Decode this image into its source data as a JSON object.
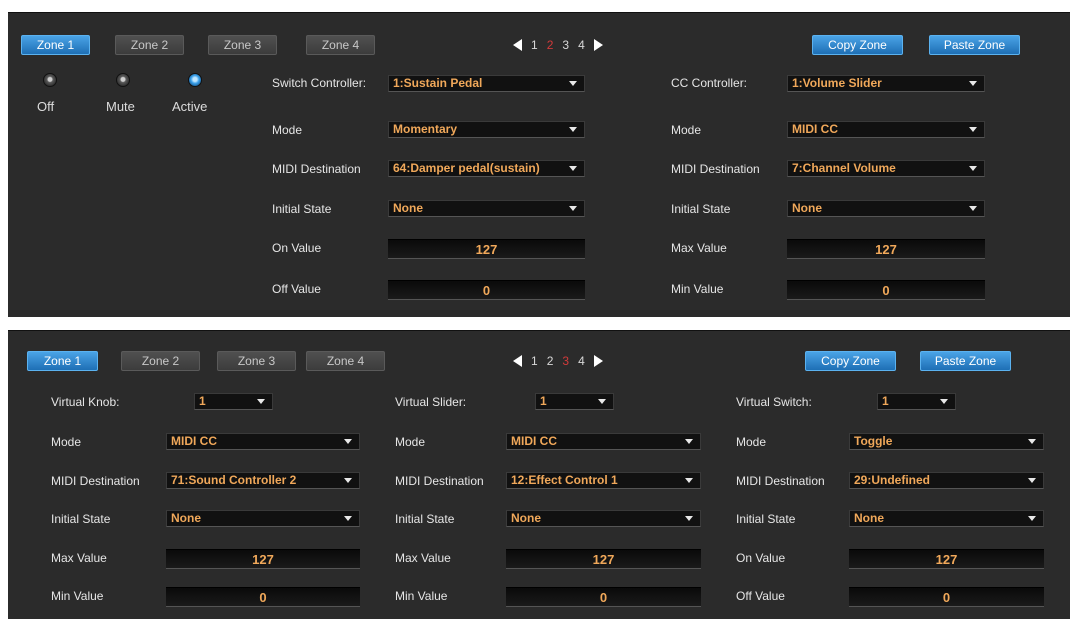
{
  "top_panel": {
    "zones": [
      "Zone 1",
      "Zone 2",
      "Zone 3",
      "Zone 4"
    ],
    "active_zone": "Zone 1",
    "pages": [
      "1",
      "2",
      "3",
      "4"
    ],
    "current_page": "2",
    "copy_zone": "Copy Zone",
    "paste_zone": "Paste Zone",
    "modes": [
      "Off",
      "Mute",
      "Active"
    ],
    "selected_mode": "Active",
    "switch": {
      "controller_label": "Switch Controller:",
      "controller_value": "1:Sustain Pedal",
      "mode_label": "Mode",
      "mode_value": "Momentary",
      "dest_label": "MIDI Destination",
      "dest_value": "64:Damper pedal(sustain)",
      "initial_label": "Initial State",
      "initial_value": "None",
      "on_label": "On Value",
      "on_value": "127",
      "off_label": "Off Value",
      "off_value": "0"
    },
    "cc": {
      "controller_label": "CC Controller:",
      "controller_value": "1:Volume Slider",
      "mode_label": "Mode",
      "mode_value": "MIDI CC",
      "dest_label": "MIDI Destination",
      "dest_value": "7:Channel Volume",
      "initial_label": "Initial State",
      "initial_value": "None",
      "max_label": "Max Value",
      "max_value": "127",
      "min_label": "Min Value",
      "min_value": "0"
    }
  },
  "bottom_panel": {
    "zones": [
      "Zone 1",
      "Zone 2",
      "Zone 3",
      "Zone 4"
    ],
    "active_zone": "Zone 1",
    "pages": [
      "1",
      "2",
      "3",
      "4"
    ],
    "current_page": "3",
    "copy_zone": "Copy Zone",
    "paste_zone": "Paste Zone",
    "knob": {
      "label": "Virtual Knob:",
      "value": "1",
      "mode_label": "Mode",
      "mode_value": "MIDI CC",
      "dest_label": "MIDI Destination",
      "dest_value": "71:Sound Controller 2",
      "initial_label": "Initial State",
      "initial_value": "None",
      "max_label": "Max Value",
      "max_value": "127",
      "min_label": "Min Value",
      "min_value": "0"
    },
    "slider": {
      "label": "Virtual Slider:",
      "value": "1",
      "mode_label": "Mode",
      "mode_value": "MIDI CC",
      "dest_label": "MIDI Destination",
      "dest_value": "12:Effect Control 1",
      "initial_label": "Initial State",
      "initial_value": "None",
      "max_label": "Max Value",
      "max_value": "127",
      "min_label": "Min Value",
      "min_value": "0"
    },
    "switch": {
      "label": "Virtual Switch:",
      "value": "1",
      "mode_label": "Mode",
      "mode_value": "Toggle",
      "dest_label": "MIDI Destination",
      "dest_value": "29:Undefined",
      "initial_label": "Initial State",
      "initial_value": "None",
      "on_label": "On Value",
      "on_value": "127",
      "off_label": "Off Value",
      "off_value": "0"
    }
  }
}
